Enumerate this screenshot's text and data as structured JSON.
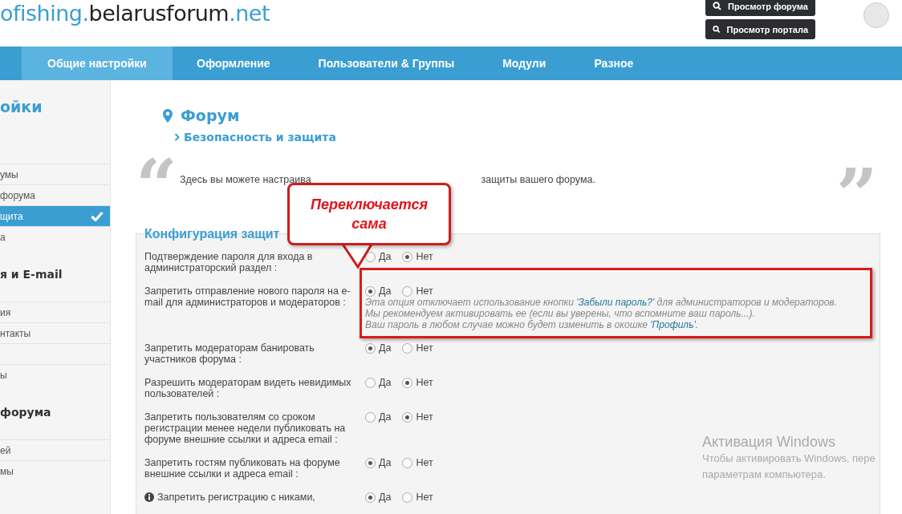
{
  "header": {
    "logo": [
      {
        "text": "ofishing.",
        "kind": "accent"
      },
      {
        "text": "belarusforum",
        "kind": "plain"
      },
      {
        "text": ".net",
        "kind": "accent"
      }
    ],
    "buttons": [
      "Просмотр форума",
      "Просмотр портала"
    ]
  },
  "nav": [
    {
      "label": "Общие настройки",
      "selected": true
    },
    {
      "label": "Оформление",
      "selected": false
    },
    {
      "label": "Пользователи & Группы",
      "selected": false
    },
    {
      "label": "Модули",
      "selected": false
    },
    {
      "label": "Разное",
      "selected": false
    }
  ],
  "sidebar": [
    {
      "title": "ойки",
      "kind": "main",
      "items": [
        {
          "label": "умы",
          "selected": false
        },
        {
          "label": "форума",
          "selected": false
        },
        {
          "label": "щита",
          "selected": true
        },
        {
          "label": "а",
          "selected": false
        }
      ]
    },
    {
      "title": "я и E-mail",
      "kind": "sub",
      "items": [
        {
          "label": "ия",
          "selected": false
        },
        {
          "label": "нтакты",
          "selected": false
        },
        {
          "selected": false
        },
        {
          "label": "ы",
          "selected": false
        }
      ]
    },
    {
      "title": "форума",
      "kind": "sub",
      "items": [
        {
          "label": "ей",
          "selected": false
        },
        {
          "label": "мы",
          "selected": false
        }
      ]
    }
  ],
  "page": {
    "title": "Форум",
    "breadcrumb": "Безопасность и защита",
    "intro_start": "Здесь вы можете настраива",
    "intro_end": "защиты вашего форума.",
    "quote_open": "“",
    "quote_close": "”"
  },
  "section": {
    "title": "Конфигурация защит",
    "rows": [
      {
        "label": "Подтверждение пароля для входа в администраторский раздел :",
        "info_icon": false,
        "options": [
          {
            "label": "Да",
            "selected": false
          },
          {
            "label": "Нет",
            "selected": true
          }
        ]
      },
      {
        "label": "Запретить отправление нового пароля на e-mail для администраторов и модераторов :",
        "info_icon": false,
        "options": [
          {
            "label": "Да",
            "selected": true
          },
          {
            "label": "Нет",
            "selected": false
          }
        ],
        "description": [
          [
            {
              "text": "Эта опция отключает использование кнопки ",
              "kind": "text"
            },
            {
              "text": "'Забыли пароль?'",
              "kind": "link"
            },
            {
              "text": " для администраторов и модераторов.",
              "kind": "text"
            }
          ],
          [
            {
              "text": "Мы рекомендуем активировать ее (если вы уверены, что вспомните ваш пароль...).",
              "kind": "text"
            }
          ],
          [
            {
              "text": "Ваш пароль в любом случае можно будет изменить в окошке ",
              "kind": "text"
            },
            {
              "text": "'Профиль'",
              "kind": "link"
            },
            {
              "text": ".",
              "kind": "text"
            }
          ]
        ]
      },
      {
        "label": "Запретить модераторам банировать участников форума :",
        "info_icon": false,
        "options": [
          {
            "label": "Да",
            "selected": true
          },
          {
            "label": "Нет",
            "selected": false
          }
        ]
      },
      {
        "label": "Разрешить модераторам видеть невидимых пользователей :",
        "info_icon": false,
        "options": [
          {
            "label": "Да",
            "selected": false
          },
          {
            "label": "Нет",
            "selected": true
          }
        ]
      },
      {
        "label": "Запретить пользователям со сроком регистрации менее недели публиковать на форуме внешние ссылки и адреса email :",
        "info_icon": false,
        "options": [
          {
            "label": "Да",
            "selected": false
          },
          {
            "label": "Нет",
            "selected": true
          }
        ]
      },
      {
        "label": "Запретить гостям публиковать на форуме внешние ссылки и адреса email :",
        "info_icon": false,
        "options": [
          {
            "label": "Да",
            "selected": true
          },
          {
            "label": "Нет",
            "selected": false
          }
        ]
      },
      {
        "label": "Запретить регистрацию с никами,",
        "info_icon": true,
        "options": [
          {
            "label": "Да",
            "selected": true
          },
          {
            "label": "Нет",
            "selected": false
          }
        ]
      }
    ]
  },
  "callout": {
    "text": "Переключается сама"
  },
  "activation": {
    "title": "Активация Windows",
    "lines": [
      "Чтобы активировать Windows, пере",
      "параметрам компьютера."
    ]
  }
}
